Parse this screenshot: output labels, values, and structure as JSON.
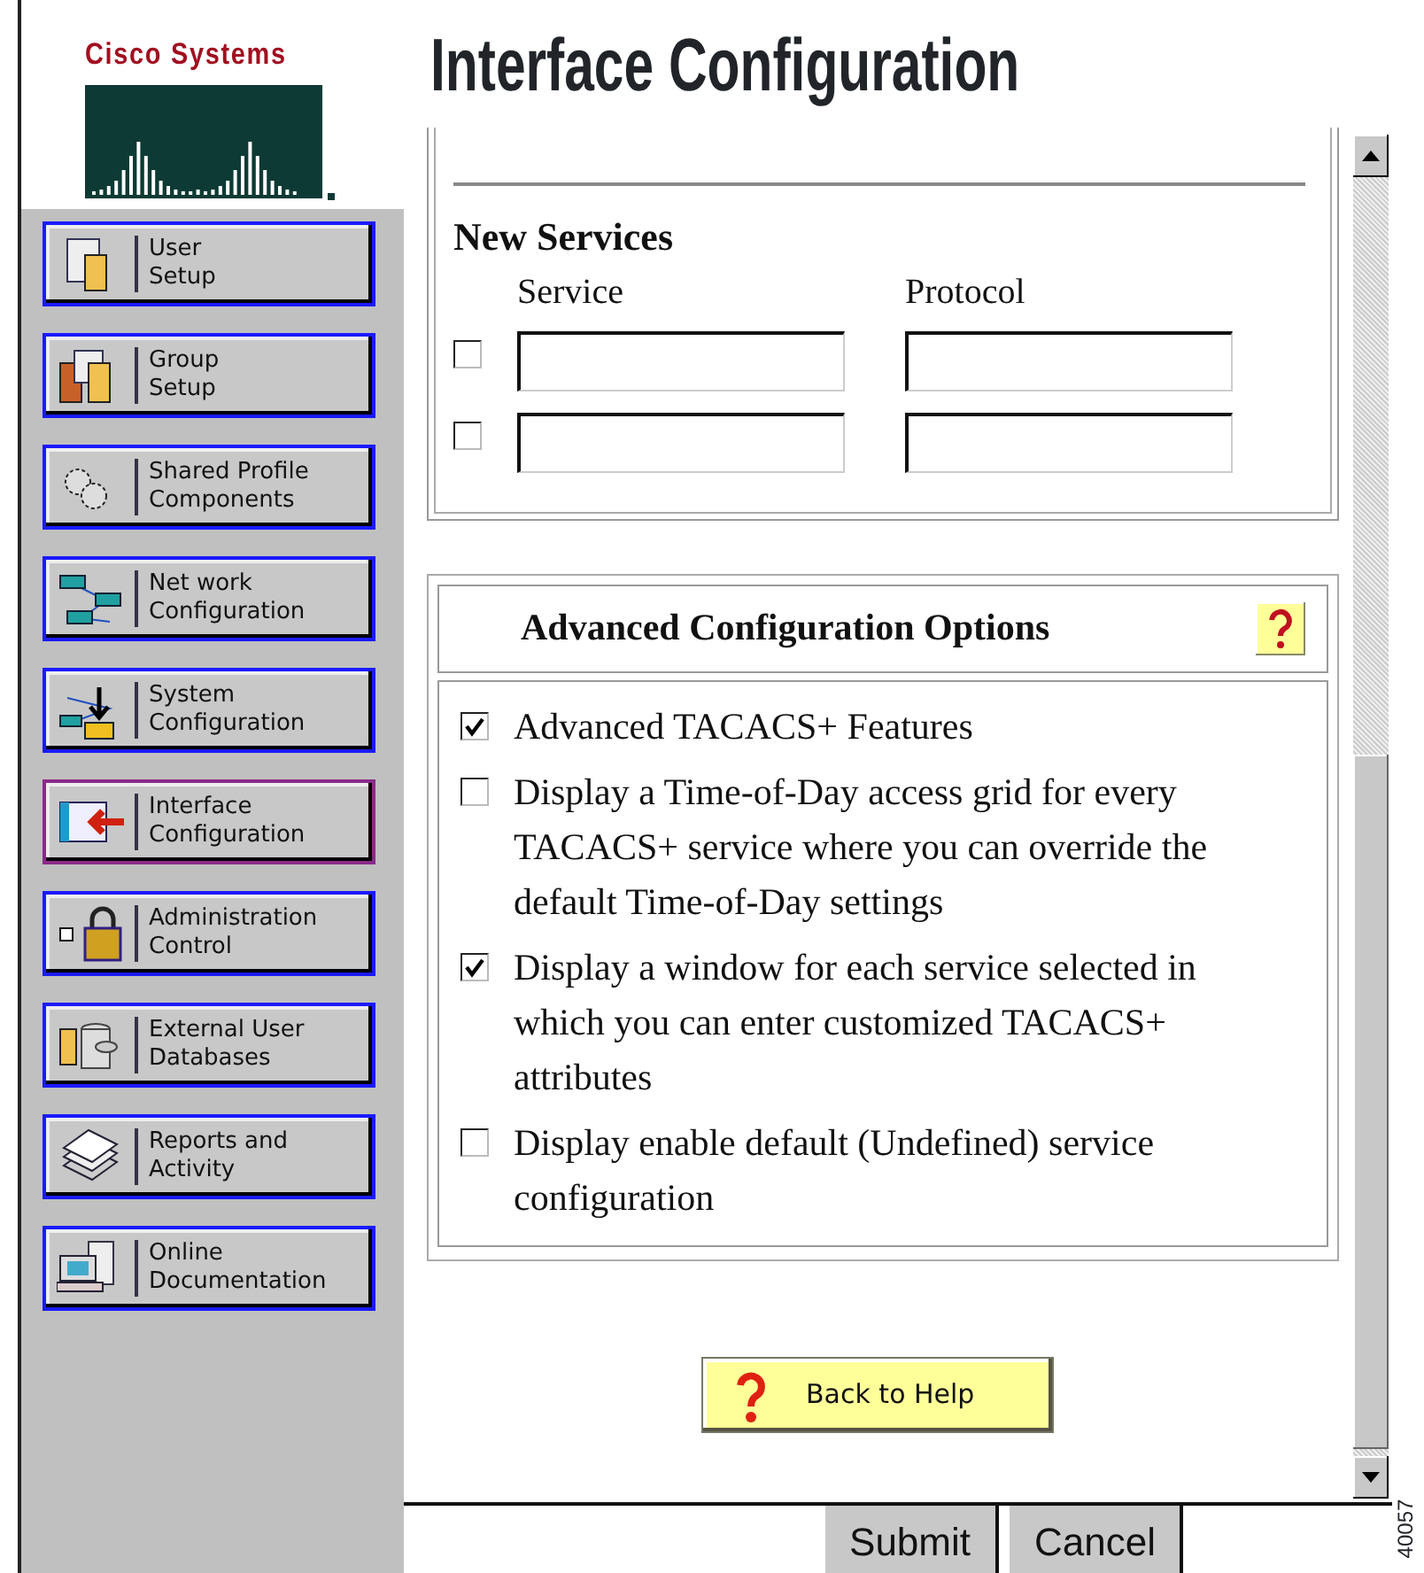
{
  "logo": {
    "text": "Cisco Systems"
  },
  "title": "Interface Configuration",
  "sidebar": {
    "items": [
      {
        "label": [
          "User",
          "Setup"
        ],
        "selected": false
      },
      {
        "label": [
          "Group",
          "Setup"
        ],
        "selected": false
      },
      {
        "label": [
          "Shared Profile",
          "Components"
        ],
        "selected": false
      },
      {
        "label": [
          "Net work",
          "Configuration"
        ],
        "selected": false
      },
      {
        "label": [
          "System",
          "Configuration"
        ],
        "selected": false
      },
      {
        "label": [
          "Interface",
          "Configuration"
        ],
        "selected": true
      },
      {
        "label": [
          "Administration",
          "Control"
        ],
        "selected": false
      },
      {
        "label": [
          "External User",
          "Databases"
        ],
        "selected": false
      },
      {
        "label": [
          "Reports and",
          "Activity"
        ],
        "selected": false
      },
      {
        "label": [
          "Online",
          "Documentation"
        ],
        "selected": false
      }
    ]
  },
  "new_services": {
    "heading": "New Services",
    "columns": [
      "Service",
      "Protocol"
    ],
    "rows": [
      {
        "checked": false
      },
      {
        "checked": false
      }
    ]
  },
  "advanced": {
    "heading": "Advanced Configuration Options",
    "options": [
      {
        "label": "Advanced TACACS+ Features",
        "checked": true
      },
      {
        "label": "Display a Time-of-Day access grid for every TACACS+ service where you can override the default Time-of-Day settings",
        "checked": false
      },
      {
        "label": "Display a window for each service selected in which you can enter customized TACACS+ attributes",
        "checked": true
      },
      {
        "label": "Display enable default (Undefined) service configuration",
        "checked": false
      }
    ]
  },
  "help_button": "Back to Help",
  "buttons": [
    "Submit",
    "Cancel"
  ],
  "figure_id": "40057"
}
